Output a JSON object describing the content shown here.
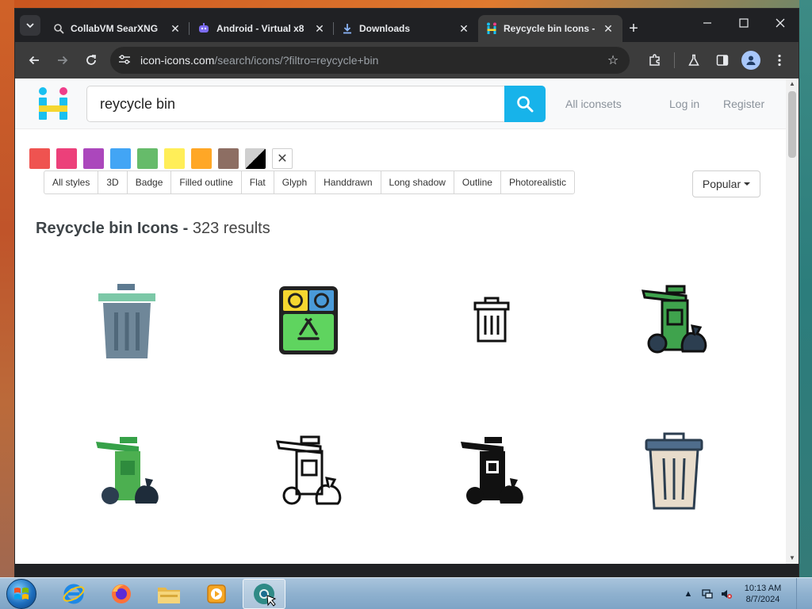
{
  "browser": {
    "tabs": [
      {
        "title": "CollabVM SearXNG",
        "icon": "searxng-icon",
        "active": false
      },
      {
        "title": "Android - Virtual x8",
        "icon": "android-vm-icon",
        "active": false
      },
      {
        "title": "Downloads",
        "icon": "download-icon",
        "active": false
      },
      {
        "title": "Reycycle bin Icons -",
        "icon": "icon-icons-favicon",
        "active": true
      }
    ],
    "address": {
      "host": "icon-icons.com",
      "path": "/search/icons/?filtro=reycycle+bin"
    }
  },
  "site": {
    "search_value": "reycycle bin",
    "nav": {
      "all_iconsets": "All iconsets",
      "login": "Log in",
      "register": "Register"
    },
    "color_filters": [
      "#ef5350",
      "#ec407a",
      "#ab47bc",
      "#42a5f5",
      "#66bb6a",
      "#ffee58",
      "#ffa726",
      "#8d6e63",
      "black-white",
      "clear"
    ],
    "styles": [
      "All styles",
      "3D",
      "Badge",
      "Filled outline",
      "Flat",
      "Glyph",
      "Handdrawn",
      "Long shadow",
      "Outline",
      "Photorealistic"
    ],
    "sort": {
      "label": "Popular"
    },
    "results": {
      "term": "Reycycle bin Icons",
      "separator": "-",
      "count": "323 results"
    },
    "icons": [
      "flat-trash-can-icon",
      "recycle-bins-icon",
      "outline-trash-can-icon",
      "filled-outline-wheelie-bin-icon",
      "flat-wheelie-bin-icon",
      "outline-wheelie-bin-icon",
      "glyph-wheelie-bin-icon",
      "filled-outline-trash-can-icon"
    ]
  },
  "taskbar": {
    "apps": [
      "internet-explorer-icon",
      "firefox-icon",
      "file-explorer-icon",
      "media-player-icon",
      "chrome-icon"
    ],
    "time": "10:13 AM",
    "date": "8/7/2024"
  }
}
